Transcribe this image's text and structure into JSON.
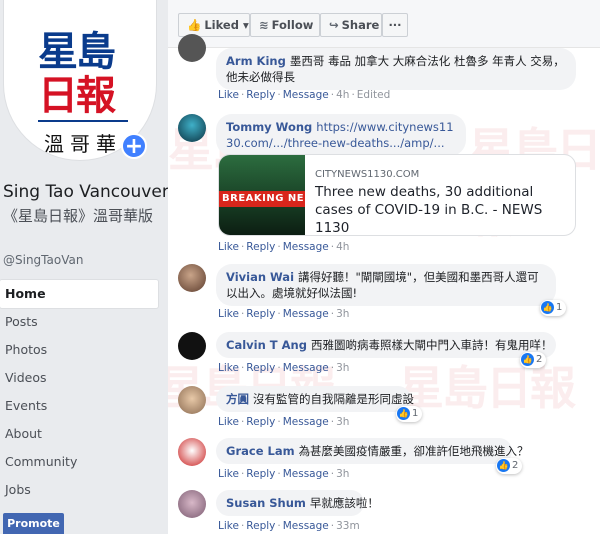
{
  "page": {
    "logo_line1": "星島",
    "logo_line2": "日報",
    "logo_line3": "溫哥華",
    "name": "Sing Tao Vancouver",
    "subtitle": "《星島日報》溫哥華版",
    "handle": "@SingTaoVan"
  },
  "nav": [
    "Home",
    "Posts",
    "Photos",
    "Videos",
    "Events",
    "About",
    "Community",
    "Jobs"
  ],
  "promote_label": "Promote",
  "toolbar": {
    "liked": "Liked",
    "follow": "Follow",
    "share": "Share",
    "more": "···"
  },
  "action_labels": {
    "like": "Like",
    "reply": "Reply",
    "message": "Message"
  },
  "comments": [
    {
      "name": "Arm King",
      "text": "墨西哥 毒品 加拿大 大麻合法化 杜魯多 年青人 交易，他未必做得長",
      "time": "4h",
      "edited": "Edited"
    },
    {
      "name": "Tommy Wong",
      "text": "https://www.citynews1130.com/.../three-new-deaths.../amp/...",
      "time": "4h",
      "preview": {
        "domain": "CITYNEWS1130.COM",
        "title": "Three new deaths, 30 additional cases of COVID-19 in B.C. - NEWS 1130",
        "image_text": "BREAKING NE"
      }
    },
    {
      "name": "Vivian Wai",
      "text": "講得好聽！\"閘閘國境\"，但美國和墨西哥人還可以出入。處境就好似法國!",
      "time": "3h",
      "reactions": "1"
    },
    {
      "name": "Calvin T Ang",
      "text": "西雅圖啲病毒照樣大閘中門入車詩！有鬼用咩！",
      "time": "3h",
      "reactions": "2"
    },
    {
      "name": "方圓",
      "text": "沒有監管的自我隔離是形同虛設",
      "time": "3h",
      "reactions": "1"
    },
    {
      "name": "Grace Lam",
      "text": "為甚麼美國疫情嚴重，卻准許佢地飛機進入？",
      "time": "3h",
      "reactions": "2"
    },
    {
      "name": "Susan Shum",
      "text": "早就應該啦！",
      "time": "33m"
    }
  ],
  "watermark": "星島日報",
  "colors": {
    "fb_blue": "#4267b2",
    "link": "#385898",
    "bubble": "#f2f3f5",
    "logo_blue": "#0a3b8c",
    "logo_red": "#d51224"
  }
}
